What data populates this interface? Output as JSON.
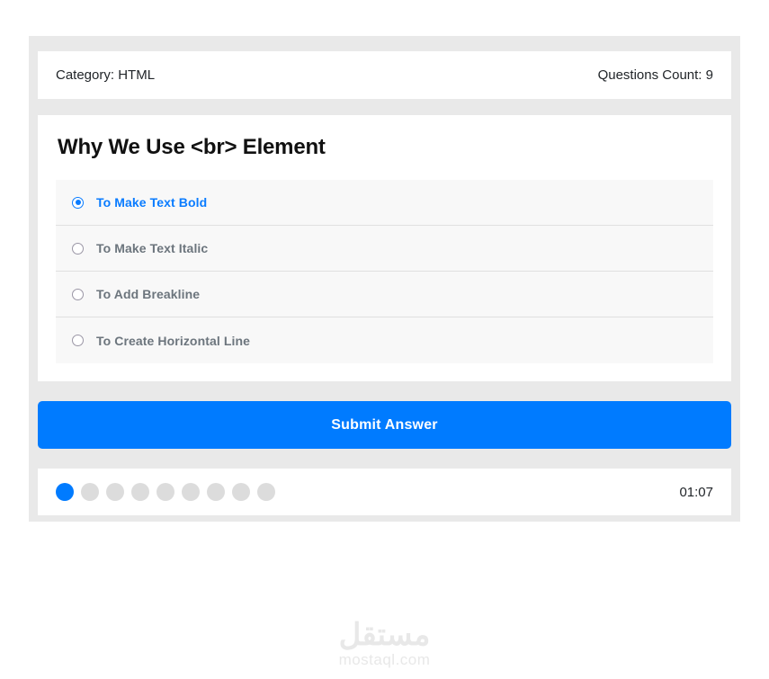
{
  "header": {
    "category_text": "Category: HTML",
    "questions_count_text": "Questions Count: 9"
  },
  "question": {
    "title": "Why We Use <br> Element",
    "options": [
      {
        "label": "To Make Text Bold",
        "selected": true
      },
      {
        "label": "To Make Text Italic",
        "selected": false
      },
      {
        "label": "To Add Breakline",
        "selected": false
      },
      {
        "label": "To Create Horizontal Line",
        "selected": false
      }
    ]
  },
  "actions": {
    "submit_label": "Submit Answer"
  },
  "footer": {
    "progress": {
      "total": 9,
      "current": 1
    },
    "timer_text": "01:07"
  },
  "watermark": {
    "arabic": "مستقل",
    "latin": "mostaql.com"
  },
  "colors": {
    "accent": "#007bff",
    "selected_option": "#0a7cff",
    "option_text": "#6c757d",
    "shell_background": "#e9e9e9",
    "option_background": "#f8f8f8",
    "dot_inactive": "#dcdcdc"
  }
}
